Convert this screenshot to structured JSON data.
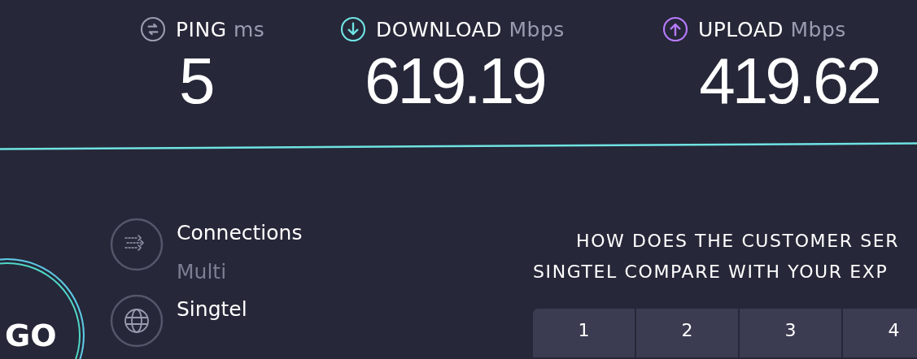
{
  "metrics": [
    {
      "kind": "ping",
      "label": "PING",
      "unit": "ms",
      "value": "5"
    },
    {
      "kind": "download",
      "label": "DOWNLOAD",
      "unit": "Mbps",
      "value": "619.19"
    },
    {
      "kind": "upload",
      "label": "UPLOAD",
      "unit": "Mbps",
      "value": "419.62"
    }
  ],
  "go_button": {
    "label": "GO"
  },
  "info": [
    {
      "kind": "connections",
      "title": "Connections",
      "subtitle": "Multi"
    },
    {
      "kind": "provider",
      "title": "Singtel"
    }
  ],
  "survey": {
    "question_lines": [
      "HOW DOES THE CUSTOMER SER",
      "SINGTEL COMPARE WITH YOUR EXP"
    ],
    "ratings": [
      "1",
      "2",
      "3",
      "4"
    ]
  }
}
